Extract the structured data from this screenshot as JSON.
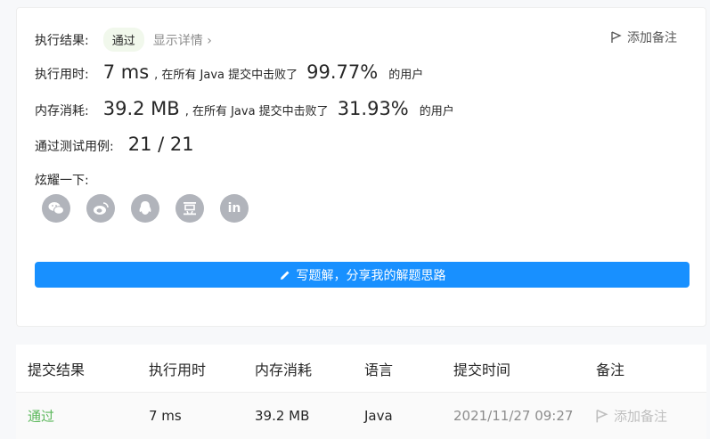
{
  "summary": {
    "result_label": "执行结果:",
    "result_value": "通过",
    "details_link": "显示详情",
    "add_note": "添加备注",
    "runtime_label": "执行用时:",
    "runtime_value": "7 ms",
    "runtime_mid": ", 在所有 Java 提交中击败了",
    "runtime_percent": "99.77%",
    "runtime_suffix": "的用户",
    "memory_label": "内存消耗:",
    "memory_value": "39.2 MB",
    "memory_mid": ", 在所有 Java 提交中击败了",
    "memory_percent": "31.93%",
    "memory_suffix": "的用户",
    "tests_label": "通过测试用例:",
    "tests_value": "21 / 21",
    "share_label": "炫耀一下:",
    "share_icons": [
      "wechat-icon",
      "weibo-icon",
      "qq-icon",
      "douban-icon",
      "linkedin-icon"
    ],
    "write_button": "写题解，分享我的解题思路"
  },
  "table": {
    "headers": [
      "提交结果",
      "执行用时",
      "内存消耗",
      "语言",
      "提交时间",
      "备注"
    ],
    "row": {
      "status": "通过",
      "runtime": "7 ms",
      "memory": "39.2 MB",
      "language": "Java",
      "time": "2021/11/27 09:27",
      "note": "添加备注"
    }
  },
  "colors": {
    "accent": "#1890ff",
    "pass": "#5cb85c",
    "share_icon_bg": "#b1b4bb"
  }
}
